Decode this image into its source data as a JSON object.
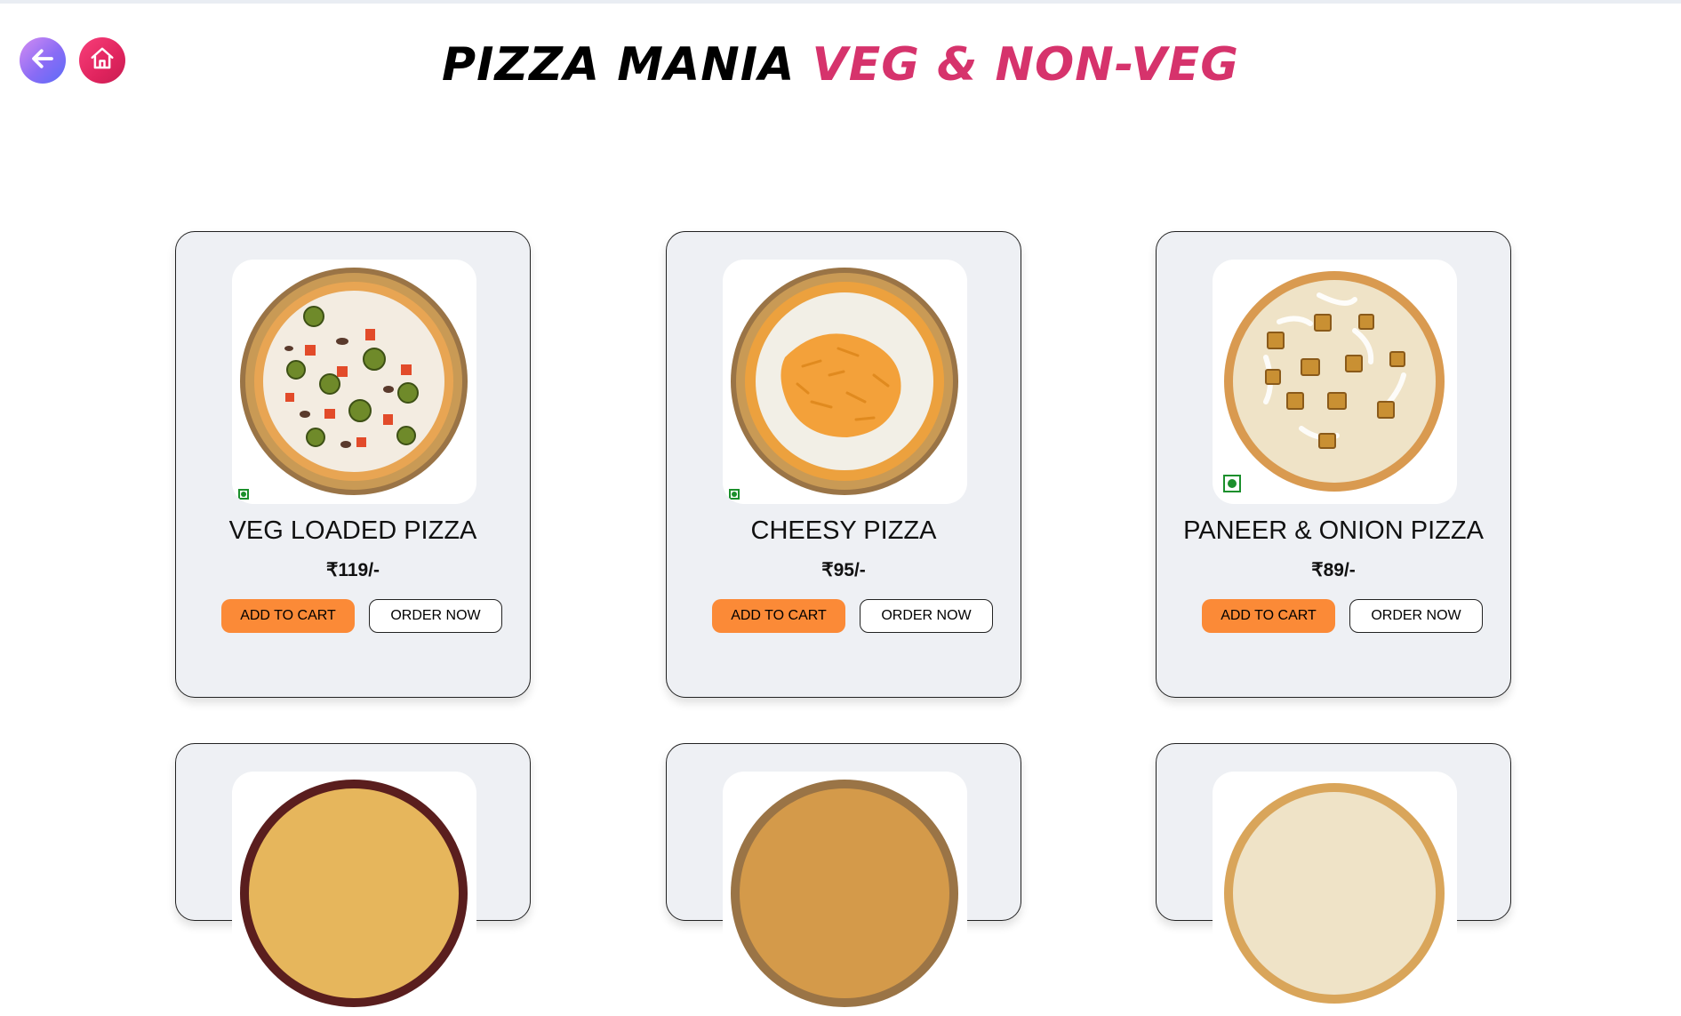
{
  "nav": {
    "back_label": "Back",
    "home_label": "Home"
  },
  "header": {
    "title_main": "PIZZA MANIA",
    "title_accent": "VEG & NON-VEG"
  },
  "products": [
    {
      "name": "VEG LOADED PIZZA",
      "price": "₹119/-",
      "add_label": "ADD TO CART",
      "order_label": "ORDER NOW"
    },
    {
      "name": "CHEESY PIZZA",
      "price": "₹95/-",
      "add_label": "ADD TO CART",
      "order_label": "ORDER NOW"
    },
    {
      "name": "PANEER & ONION PIZZA",
      "price": "₹89/-",
      "add_label": "ADD TO CART",
      "order_label": "ORDER NOW"
    }
  ],
  "colors": {
    "accent_pink": "#d6336c",
    "cart_orange": "#fb8a37",
    "card_bg": "#eef0f4",
    "veg_green": "#1b8f2c"
  }
}
